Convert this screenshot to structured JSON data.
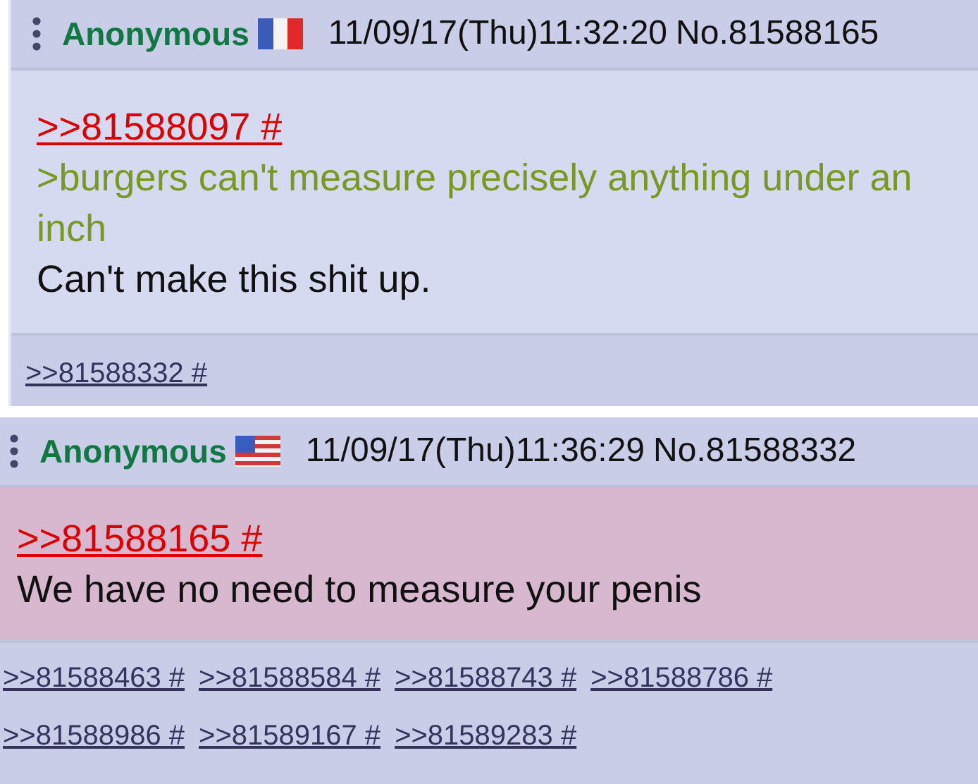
{
  "posts": [
    {
      "name": "Anonymous",
      "flag": {
        "kind": "france"
      },
      "datetime": "11/09/17(Thu)11:32:20",
      "number": "No.81588165",
      "highlighted": false,
      "lines": [
        {
          "kind": "quotelink",
          "text": ">>81588097 #"
        },
        {
          "kind": "greentext",
          "text": ">burgers can't measure precisely anything under an inch"
        },
        {
          "kind": "text",
          "text": "Can't make this shit up."
        }
      ],
      "replies": [
        ">>81588332 #"
      ]
    },
    {
      "name": "Anonymous",
      "flag": {
        "kind": "usa"
      },
      "datetime": "11/09/17(Thu)11:36:29",
      "number": "No.81588332",
      "highlighted": true,
      "lines": [
        {
          "kind": "quotelink",
          "text": ">>81588165 #"
        },
        {
          "kind": "text",
          "text": "We have no need to measure your penis"
        }
      ],
      "replies": [
        ">>81588463 #",
        ">>81588584 #",
        ">>81588743 #",
        ">>81588786 #",
        ">>81588986 #",
        ">>81589167 #",
        ">>81589283 #"
      ]
    }
  ]
}
